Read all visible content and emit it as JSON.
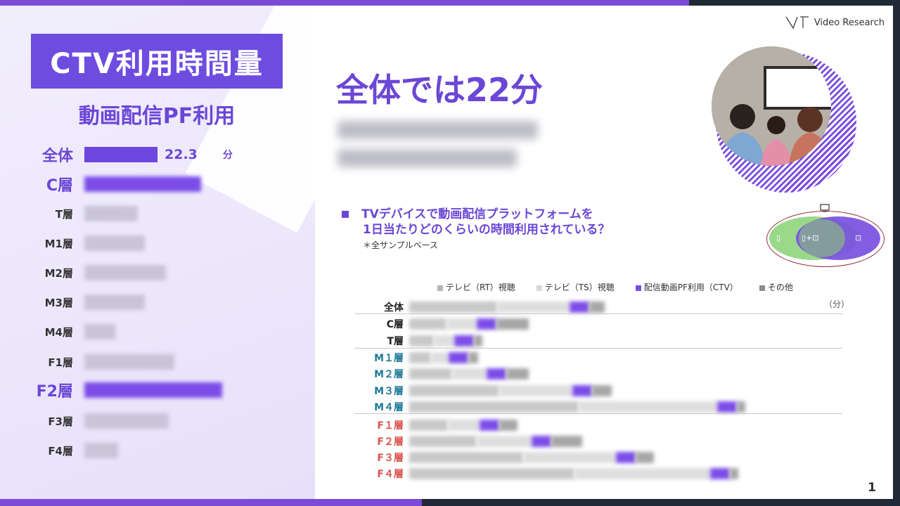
{
  "logo": {
    "text": "Video Research"
  },
  "left_panel": {
    "title": "CTV利用時間量",
    "subtitle": "動画配信PF利用",
    "segments": [
      {
        "label": "全体",
        "value": "22.3",
        "unit": "分"
      },
      {
        "label": "C層"
      },
      {
        "label": "T層"
      },
      {
        "label": "M1層"
      },
      {
        "label": "M2層"
      },
      {
        "label": "M3層"
      },
      {
        "label": "M4層"
      },
      {
        "label": "F1層"
      },
      {
        "label": "F2層"
      },
      {
        "label": "F3層"
      },
      {
        "label": "F4層"
      }
    ]
  },
  "headline": "全体では22分",
  "question": {
    "line1": "TVデバイスで動画配信プラットフォームを",
    "line2": "1日当たりどのくらいの時間利用されている？",
    "note": "＊全サンプルベース"
  },
  "chart_data": {
    "type": "bar",
    "legend": [
      {
        "name": "テレビ（RT）視聴",
        "color": "#b5b5b5"
      },
      {
        "name": "テレビ（TS）視聴",
        "color": "#d9d9d9"
      },
      {
        "name": "配信動画PF利用（CTV）",
        "color": "#7b4ce8"
      },
      {
        "name": "その他",
        "color": "#8c8c8c"
      }
    ],
    "unit": "（分）",
    "categories": [
      "全体",
      "C層",
      "T層",
      "M１層",
      "M２層",
      "M３層",
      "M４層",
      "F１層",
      "F２層",
      "F３層",
      "F４層"
    ],
    "category_colors": [
      "#222222",
      "#222222",
      "#222222",
      "#1f7a99",
      "#1f7a99",
      "#1f7a99",
      "#1f7a99",
      "#d9534f",
      "#d9534f",
      "#d9534f",
      "#d9534f"
    ]
  },
  "page_number": "1"
}
